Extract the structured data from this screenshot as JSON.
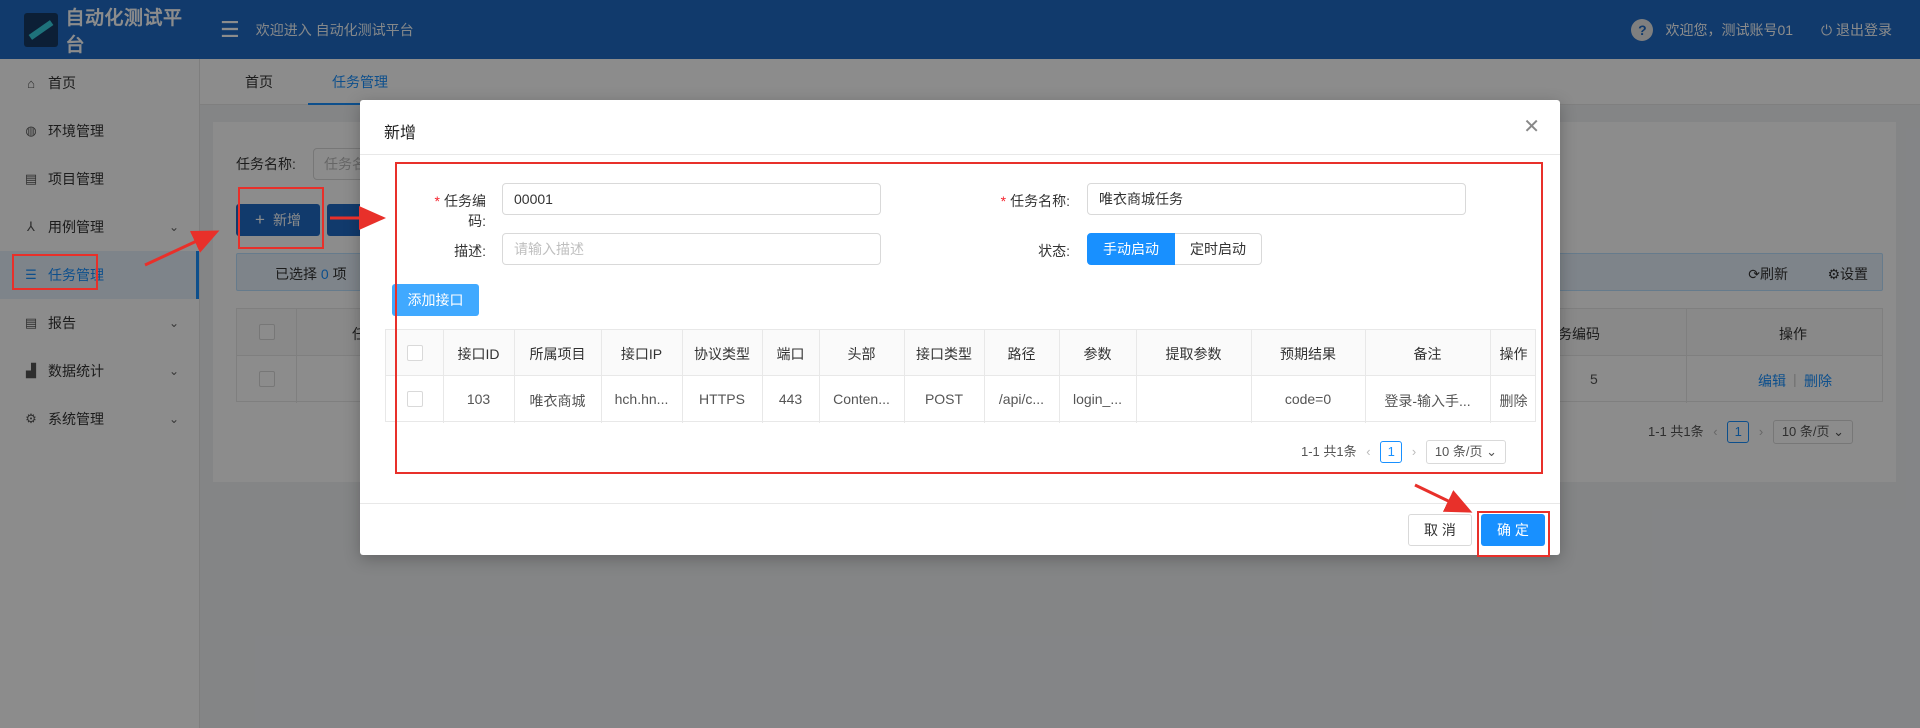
{
  "header": {
    "app_title": "自动化测试平台",
    "welcome": "欢迎进入 自动化测试平台",
    "user_greeting": "欢迎您，测试账号01",
    "logout_label": "退出登录"
  },
  "sidebar": {
    "items": [
      {
        "label": "首页",
        "icon": "home-icon"
      },
      {
        "label": "环境管理",
        "icon": "globe-icon"
      },
      {
        "label": "项目管理",
        "icon": "project-icon"
      },
      {
        "label": "用例管理",
        "icon": "cases-icon"
      },
      {
        "label": "任务管理",
        "icon": "list-icon",
        "active": true
      },
      {
        "label": "报告",
        "icon": "report-icon"
      },
      {
        "label": "数据统计",
        "icon": "chart-icon"
      },
      {
        "label": "系统管理",
        "icon": "gear-icon"
      }
    ]
  },
  "tabs": [
    "首页",
    "任务管理"
  ],
  "main": {
    "search_label": "任务名称:",
    "search_placeholder": "任务名",
    "new_button": "新增",
    "selected_prefix": "已选择",
    "selected_count": "0",
    "selected_suffix": "项",
    "refresh_label": "刷新",
    "settings_label": "设置",
    "col_name_partial": "任",
    "col_code": "任务编码",
    "col_ops": "操作",
    "row_code_partial": "5",
    "edit": "编辑",
    "delete": "删除",
    "pager_total": "1-1 共1条",
    "pager_page": "1",
    "pager_size": "10 条/页"
  },
  "modal": {
    "title": "新增",
    "close": "✕",
    "form": {
      "code_label": "任务编码:",
      "code_value": "00001",
      "name_label": "任务名称:",
      "name_value": "唯衣商城任务",
      "desc_label": "描述:",
      "desc_placeholder": "请输入描述",
      "status_label": "状态:",
      "status_options": [
        "手动启动",
        "定时启动"
      ],
      "status_selected": "手动启动"
    },
    "add_api_button": "添加接口",
    "table": {
      "columns": [
        "接口ID",
        "所属项目",
        "接口IP",
        "协议类型",
        "端口",
        "头部",
        "接口类型",
        "路径",
        "参数",
        "提取参数",
        "预期结果",
        "备注",
        "操作"
      ],
      "rows": [
        [
          "103",
          "唯衣商城",
          "hch.hn...",
          "HTTPS",
          "443",
          "Conten...",
          "POST",
          "/api/c...",
          "login_...",
          "",
          "code=0",
          "登录-输入手...",
          "删除"
        ]
      ]
    },
    "pager_total": "1-1 共1条",
    "pager_page": "1",
    "pager_size": "10 条/页",
    "cancel": "取 消",
    "ok": "确 定"
  },
  "annotation_color": "#e8302a",
  "accent_color": "#1890ff"
}
